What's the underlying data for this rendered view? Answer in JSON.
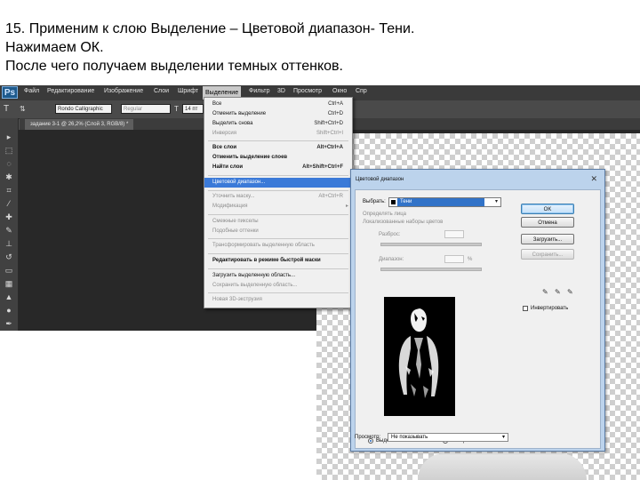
{
  "caption": {
    "line1": "15. Применим к слою Выделение – Цветовой диапазон- Тени.",
    "line2": "Нажимаем ОК.",
    "line3": "После чего получаем выделении темных оттенков."
  },
  "photoshop": {
    "logo": "Ps",
    "menu": [
      "Файл",
      "Редактирование",
      "Изображение",
      "Слои",
      "Шрифт",
      "Выделение",
      "Фильтр",
      "3D",
      "Просмотр",
      "Окно",
      "Спр"
    ],
    "active_menu": "Выделение",
    "options": {
      "font": "Rondo Calligraphic",
      "style": "Regular",
      "size": "14 пт"
    },
    "document_tab": "задание 3-1 @ 26,2% (Слой 3, RGB/8) *"
  },
  "select_menu": {
    "items": [
      {
        "label": "Все",
        "shortcut": "Ctrl+A"
      },
      {
        "label": "Отменить выделение",
        "shortcut": "Ctrl+D"
      },
      {
        "label": "Выделить снова",
        "shortcut": "Shift+Ctrl+D"
      },
      {
        "label": "Инверсия",
        "shortcut": "Shift+Ctrl+I"
      },
      {
        "label": "Все слои",
        "shortcut": "Alt+Ctrl+A"
      },
      {
        "label": "Отменить выделение слоев",
        "shortcut": ""
      },
      {
        "label": "Найти слои",
        "shortcut": "Alt+Shift+Ctrl+F"
      },
      {
        "label": "Цветовой диапазон...",
        "shortcut": ""
      },
      {
        "label": "Уточнить маску...",
        "shortcut": "Alt+Ctrl+R"
      },
      {
        "label": "Модификация",
        "shortcut": ""
      },
      {
        "label": "Смежные пикселы",
        "shortcut": ""
      },
      {
        "label": "Подобные оттенки",
        "shortcut": ""
      },
      {
        "label": "Трансформировать выделенную область",
        "shortcut": ""
      },
      {
        "label": "Редактировать в режиме быстрой маски",
        "shortcut": ""
      },
      {
        "label": "Загрузить выделенную область...",
        "shortcut": ""
      },
      {
        "label": "Сохранить выделенную область...",
        "shortcut": ""
      },
      {
        "label": "Новая 3D-экструзия",
        "shortcut": ""
      }
    ]
  },
  "color_range_dialog": {
    "title": "Цветовой диапазон",
    "close": "✕",
    "select_label": "Выбрать:",
    "select_value": "Тени",
    "detect_faces": "Определять лица",
    "localized": "Локализованные наборы цветов",
    "fuzziness_label": "Разброс:",
    "range_label": "Диапазон:",
    "range_unit": "%",
    "radio_selection": "Выделенная область",
    "radio_image": "Изображение",
    "preview_label": "Просмотр:",
    "preview_value": "Не показывать",
    "buttons": {
      "ok": "OK",
      "cancel": "Отмена",
      "load": "Загрузить...",
      "save": "Сохранить..."
    },
    "invert_label": "Инвертировать"
  }
}
